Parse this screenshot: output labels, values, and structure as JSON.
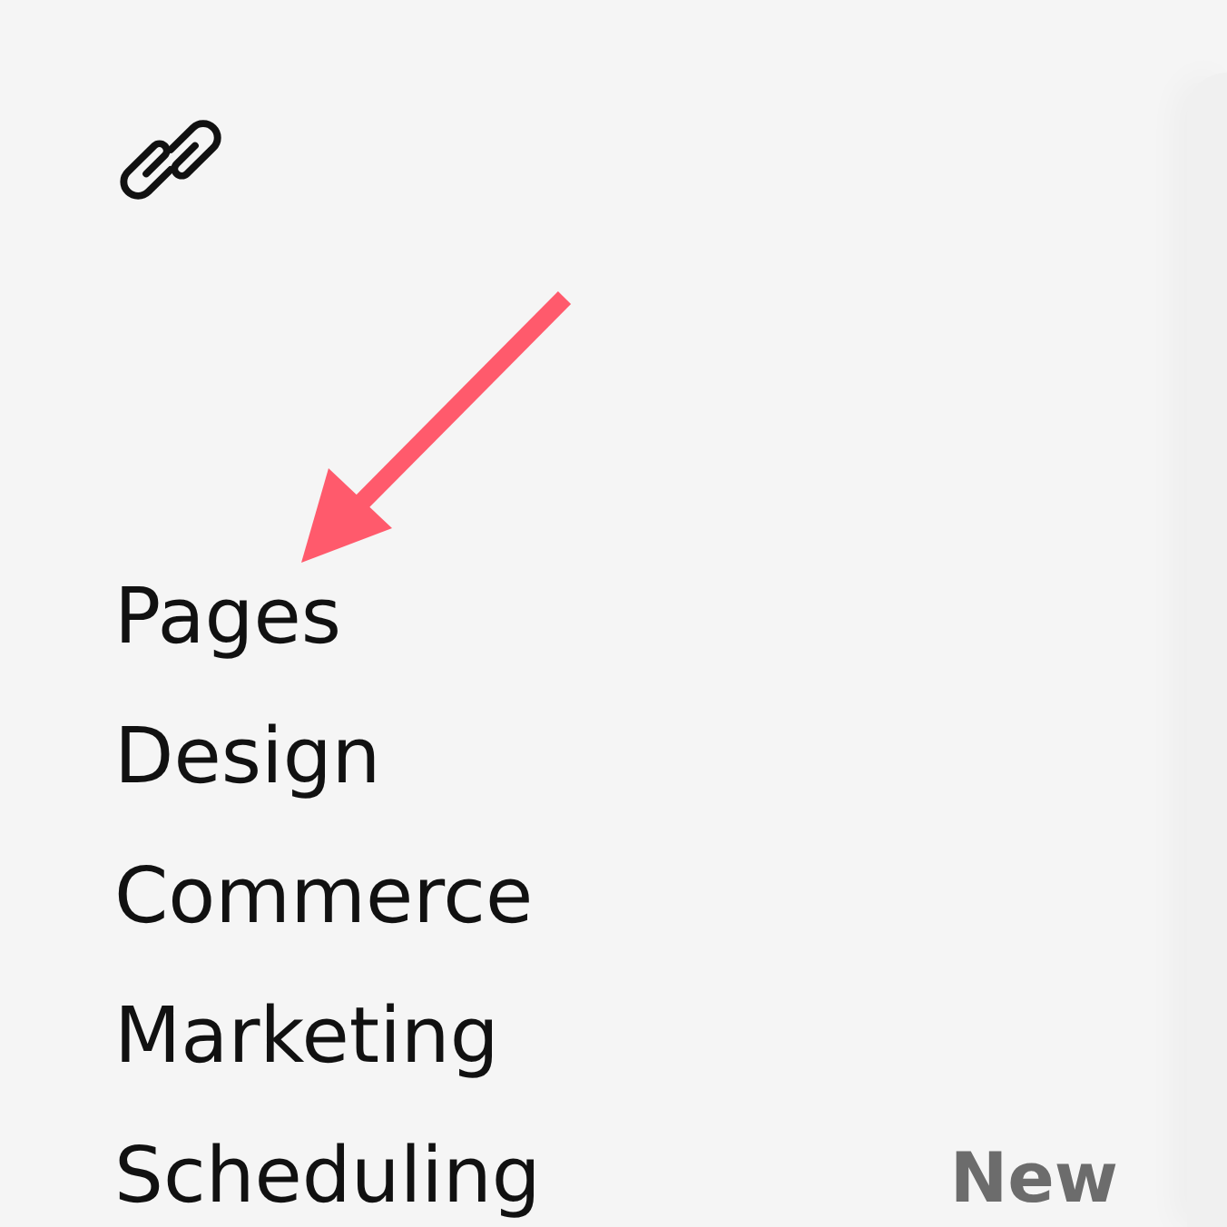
{
  "nav": {
    "items": [
      {
        "label": "Pages"
      },
      {
        "label": "Design"
      },
      {
        "label": "Commerce"
      },
      {
        "label": "Marketing"
      },
      {
        "label": "Scheduling",
        "note": "New"
      }
    ]
  }
}
